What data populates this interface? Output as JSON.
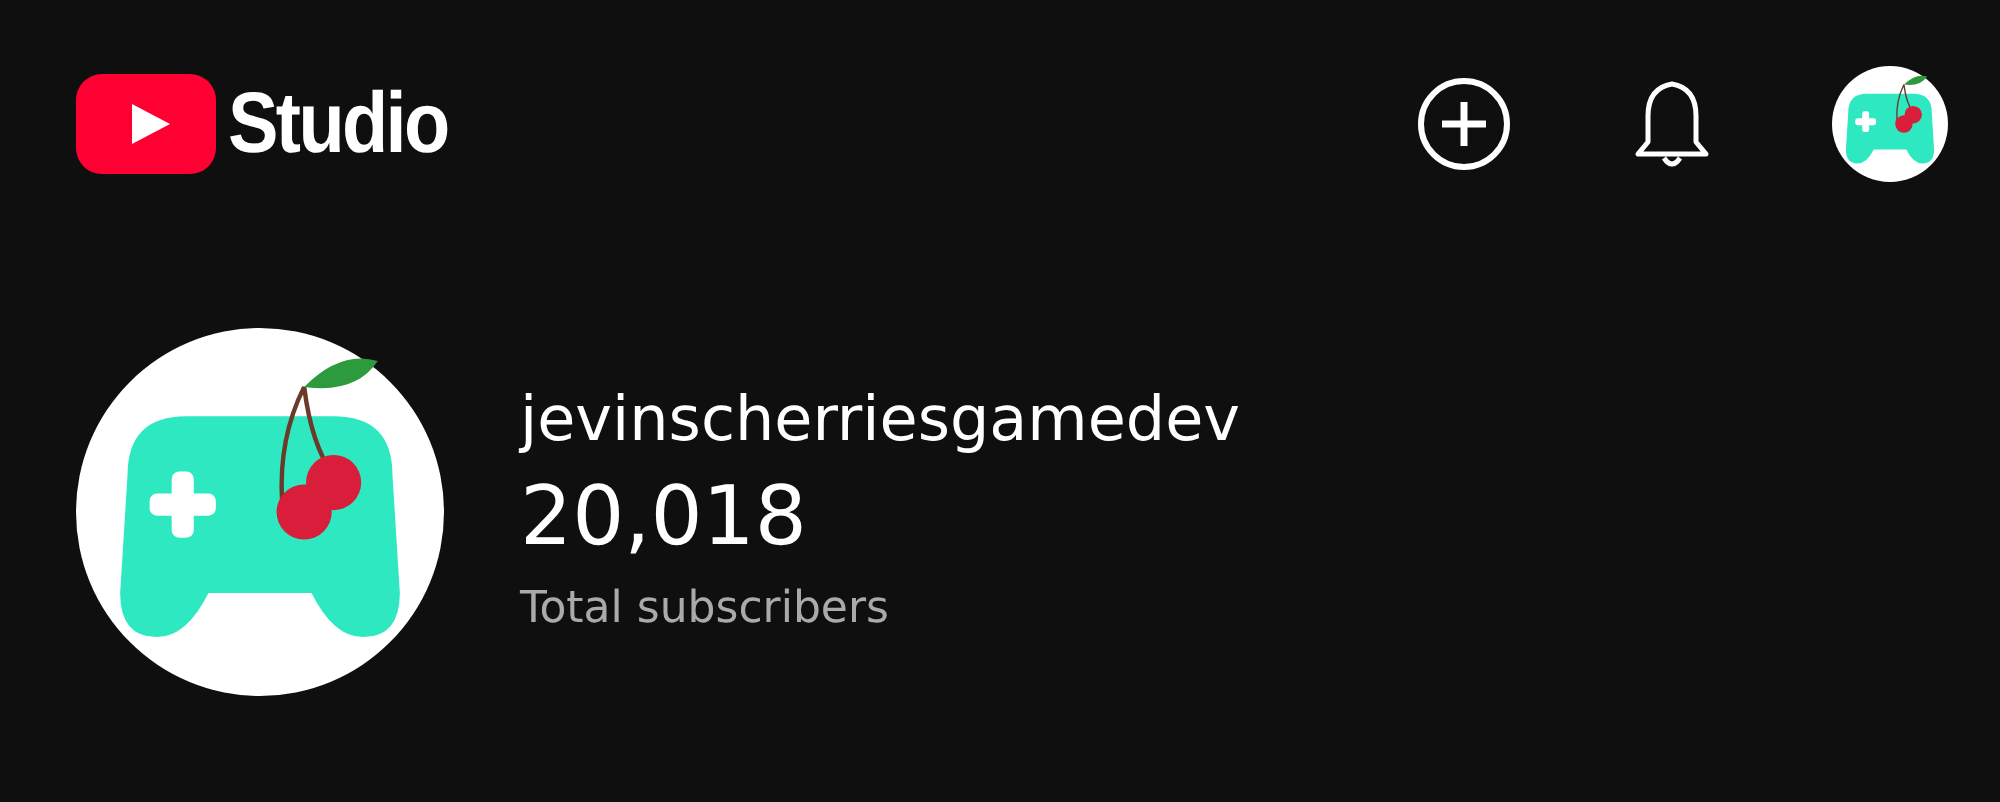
{
  "header": {
    "logo_text": "Studio"
  },
  "channel": {
    "name": "jevinscherriesgamedev",
    "subscriber_count": "20,018",
    "subscriber_label": "Total subscribers"
  }
}
